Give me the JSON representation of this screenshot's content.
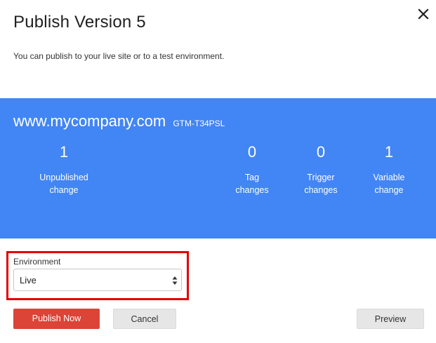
{
  "dialog": {
    "title": "Publish Version 5",
    "subtitle": "You can publish to your live site or to a test environment.",
    "close_icon": "close-icon"
  },
  "banner": {
    "color": "#4285f4",
    "domain": "www.mycompany.com",
    "container_id": "GTM-T34PSL",
    "stats": [
      {
        "value": "1",
        "label_line1": "Unpublished",
        "label_line2": "change"
      },
      {
        "value": "0",
        "label_line1": "Tag",
        "label_line2": "changes"
      },
      {
        "value": "0",
        "label_line1": "Trigger",
        "label_line2": "changes"
      },
      {
        "value": "1",
        "label_line1": "Variable",
        "label_line2": "change"
      }
    ]
  },
  "environment": {
    "label": "Environment",
    "selected": "Live",
    "highlight_color": "#e00000"
  },
  "actions": {
    "publish_label": "Publish Now",
    "publish_color": "#db4437",
    "cancel_label": "Cancel",
    "preview_label": "Preview"
  }
}
